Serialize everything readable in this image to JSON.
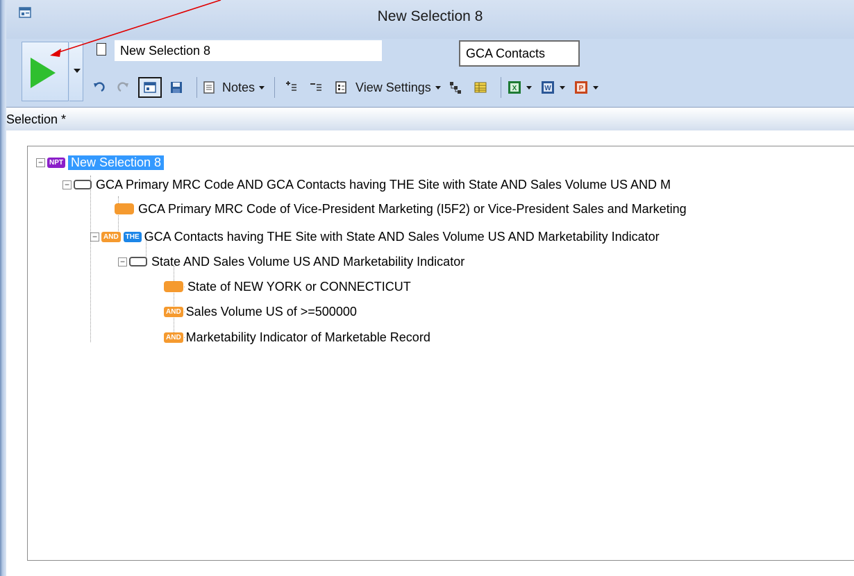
{
  "window": {
    "title": "New Selection 8"
  },
  "toolbar": {
    "selection_name": "New Selection 8",
    "table_name": "GCA Contacts",
    "notes_label": "Notes",
    "view_settings_label": "View Settings"
  },
  "selection_bar": {
    "label": "Selection *"
  },
  "tree": {
    "root": {
      "badge": "NPT",
      "label": "New Selection 8"
    },
    "group1": {
      "label": "GCA Primary MRC Code AND GCA Contacts having THE Site with State AND Sales Volume US AND M"
    },
    "leaf_mrc": {
      "label": "GCA Primary MRC Code of Vice-President Marketing (I5F2) or Vice-President Sales and Marketing"
    },
    "group2": {
      "badge_and": "AND",
      "badge_the": "THE",
      "label": "GCA Contacts having THE Site with State AND Sales Volume US AND Marketability Indicator"
    },
    "group3": {
      "label": "State AND Sales Volume US AND Marketability Indicator"
    },
    "leaf_state": {
      "label": "State of NEW YORK or CONNECTICUT"
    },
    "leaf_sales": {
      "badge": "AND",
      "label": "Sales Volume US of >=500000"
    },
    "leaf_market": {
      "badge": "AND",
      "label": "Marketability Indicator of Marketable Record"
    }
  },
  "colors": {
    "run_green": "#2fbf2f",
    "highlight": "#3399ff",
    "and_badge": "#f59a2f",
    "the_badge": "#1c86e8",
    "npt_badge": "#8b1fc9",
    "annotation_arrow": "#e00000"
  }
}
